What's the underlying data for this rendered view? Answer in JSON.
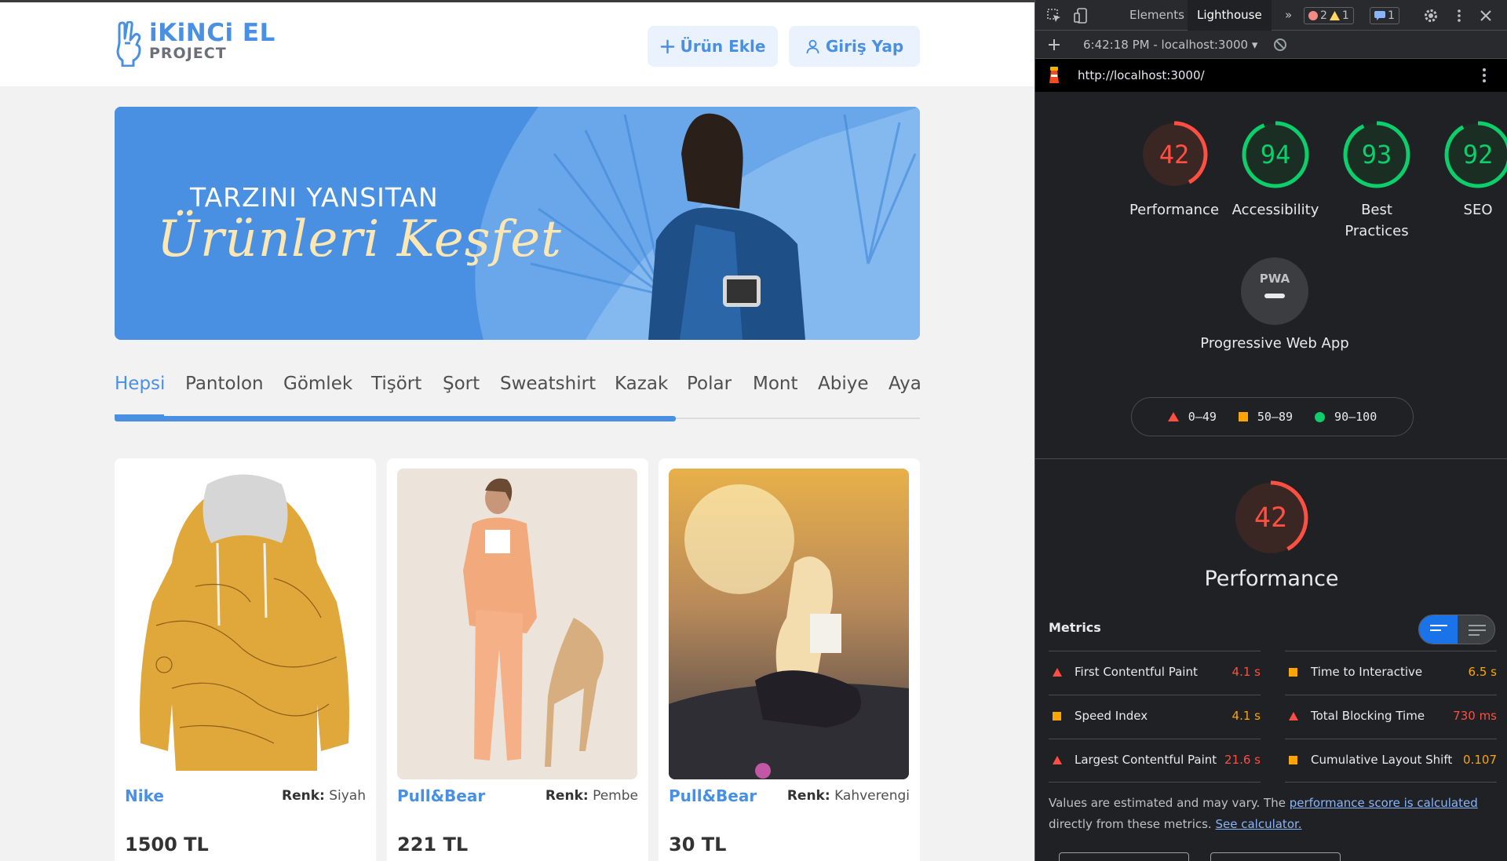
{
  "site": {
    "logo": {
      "title": "iKiNCi EL",
      "subtitle": "PROJECT"
    },
    "header_buttons": {
      "add_product": "Ürün Ekle",
      "login": "Giriş Yap"
    },
    "banner": {
      "line1": "TARZINI YANSITAN",
      "line2": "Ürünleri Keşfet"
    },
    "categories": [
      {
        "label": "Hepsi",
        "active": true
      },
      {
        "label": "Pantolon",
        "active": false
      },
      {
        "label": "Gömlek",
        "active": false
      },
      {
        "label": "Tişört",
        "active": false
      },
      {
        "label": "Şort",
        "active": false
      },
      {
        "label": "Sweatshirt",
        "active": false
      },
      {
        "label": "Kazak",
        "active": false
      },
      {
        "label": "Polar",
        "active": false
      },
      {
        "label": "Mont",
        "active": false
      },
      {
        "label": "Abiye",
        "active": false
      },
      {
        "label": "Aya",
        "active": false
      }
    ],
    "color_label": "Renk:",
    "products": [
      {
        "brand": "Nike",
        "color": "Siyah",
        "price": "1500 TL",
        "image": "map-print-hoodie"
      },
      {
        "brand": "Pull&Bear",
        "color": "Pembe",
        "price": "221 TL",
        "image": "orange-suit-model"
      },
      {
        "brand": "Pull&Bear",
        "color": "Kahverengi",
        "price": "30 TL",
        "image": "sunset-woman-sitting"
      }
    ],
    "colors": {
      "accent": "#4a90e2",
      "background": "#f2f2f2"
    }
  },
  "devtools": {
    "tabs": {
      "elements": "Elements",
      "lighthouse": "Lighthouse",
      "more": "»"
    },
    "badges": {
      "errors": "2",
      "warnings": "1",
      "messages": "1"
    },
    "report_selector": "6:42:18 PM - localhost:3000",
    "url": "http://localhost:3000/",
    "scores": [
      {
        "label": "Performance",
        "value": 42,
        "rating": "fail"
      },
      {
        "label": "Accessibility",
        "value": 94,
        "rating": "pass"
      },
      {
        "label": "Best Practices",
        "value": 93,
        "rating": "pass"
      },
      {
        "label": "SEO",
        "value": 92,
        "rating": "pass"
      }
    ],
    "pwa": {
      "badge": "PWA",
      "label": "Progressive Web App"
    },
    "legend": {
      "fail": "0–49",
      "average": "50–89",
      "pass": "90–100"
    },
    "performance": {
      "score": 42,
      "title": "Performance"
    },
    "metrics_heading": "Metrics",
    "metrics": [
      {
        "name": "First Contentful Paint",
        "value": "4.1 s",
        "rating": "fail"
      },
      {
        "name": "Time to Interactive",
        "value": "6.5 s",
        "rating": "average"
      },
      {
        "name": "Speed Index",
        "value": "4.1 s",
        "rating": "average"
      },
      {
        "name": "Total Blocking Time",
        "value": "730 ms",
        "rating": "fail"
      },
      {
        "name": "Largest Contentful Paint",
        "value": "21.6 s",
        "rating": "fail"
      },
      {
        "name": "Cumulative Layout Shift",
        "value": "0.107",
        "rating": "average"
      }
    ],
    "note": {
      "text1": "Values are estimated and may vary. The ",
      "link1": "performance score is calculated",
      "text2": " directly from these metrics. ",
      "link2": "See calculator."
    },
    "colors": {
      "fail": "#ff4e42",
      "average": "#ffa400",
      "pass": "#0cce6b",
      "panel": "#202124"
    }
  }
}
